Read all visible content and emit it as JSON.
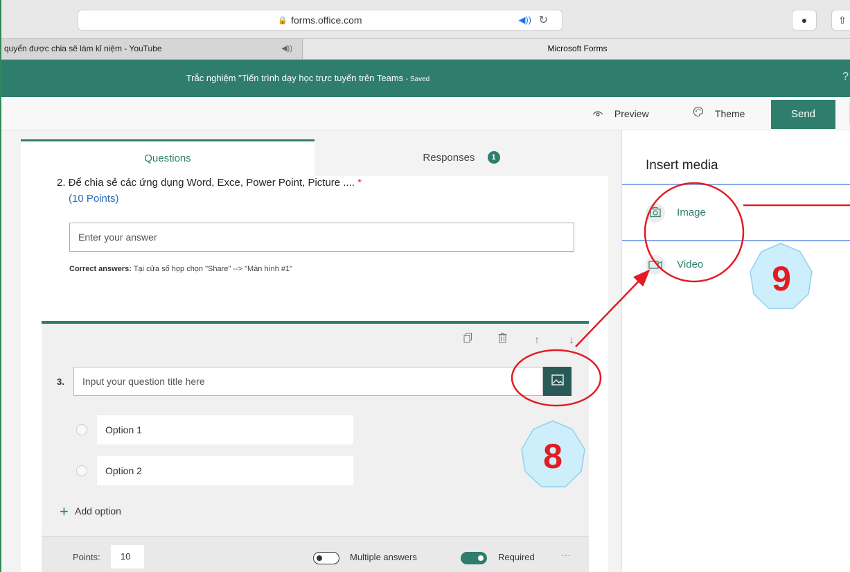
{
  "browser": {
    "url": "forms.office.com",
    "tabs": [
      {
        "label": "quyển được chia sẽ làm kỉ niệm - YouTube"
      },
      {
        "label": "Microsoft Forms"
      }
    ]
  },
  "header": {
    "title": "Trắc nghiệm \"Tiến trình dạy học trực tuyến trên Teams",
    "status": "- Saved",
    "help": "?"
  },
  "commands": {
    "preview": "Preview",
    "theme": "Theme",
    "send": "Send"
  },
  "tabs": {
    "questions": "Questions",
    "responses": "Responses",
    "responses_count": "1"
  },
  "question2": {
    "title": "2. Để chia sẻ các ứng dụng Word, Exce, Power Point, Picture ....",
    "required_mark": "*",
    "points": "(10 Points)",
    "answer_placeholder": "Enter your answer",
    "correct_label": "Correct answers:",
    "correct_value": "Tại cửa sổ họp chọn \"Share\" --> \"Màn hình #1\""
  },
  "question3": {
    "number": "3.",
    "title_placeholder": "Input your question title here",
    "options": [
      "Option 1",
      "Option 2"
    ],
    "add_option": "Add option",
    "points_label": "Points:",
    "points_value": "10",
    "multiple_answers_label": "Multiple answers",
    "multiple_answers_on": false,
    "required_label": "Required",
    "required_on": true,
    "more": "···"
  },
  "media_panel": {
    "title": "Insert media",
    "items": [
      {
        "label": "Image",
        "icon": "camera-icon"
      },
      {
        "label": "Video",
        "icon": "video-camera-icon"
      }
    ]
  },
  "annotations": {
    "step_a": "8",
    "step_b": "9",
    "color": "#e31b23",
    "badge_fill": "#cdeefb"
  },
  "colors": {
    "brand": "#2f7d6d"
  }
}
